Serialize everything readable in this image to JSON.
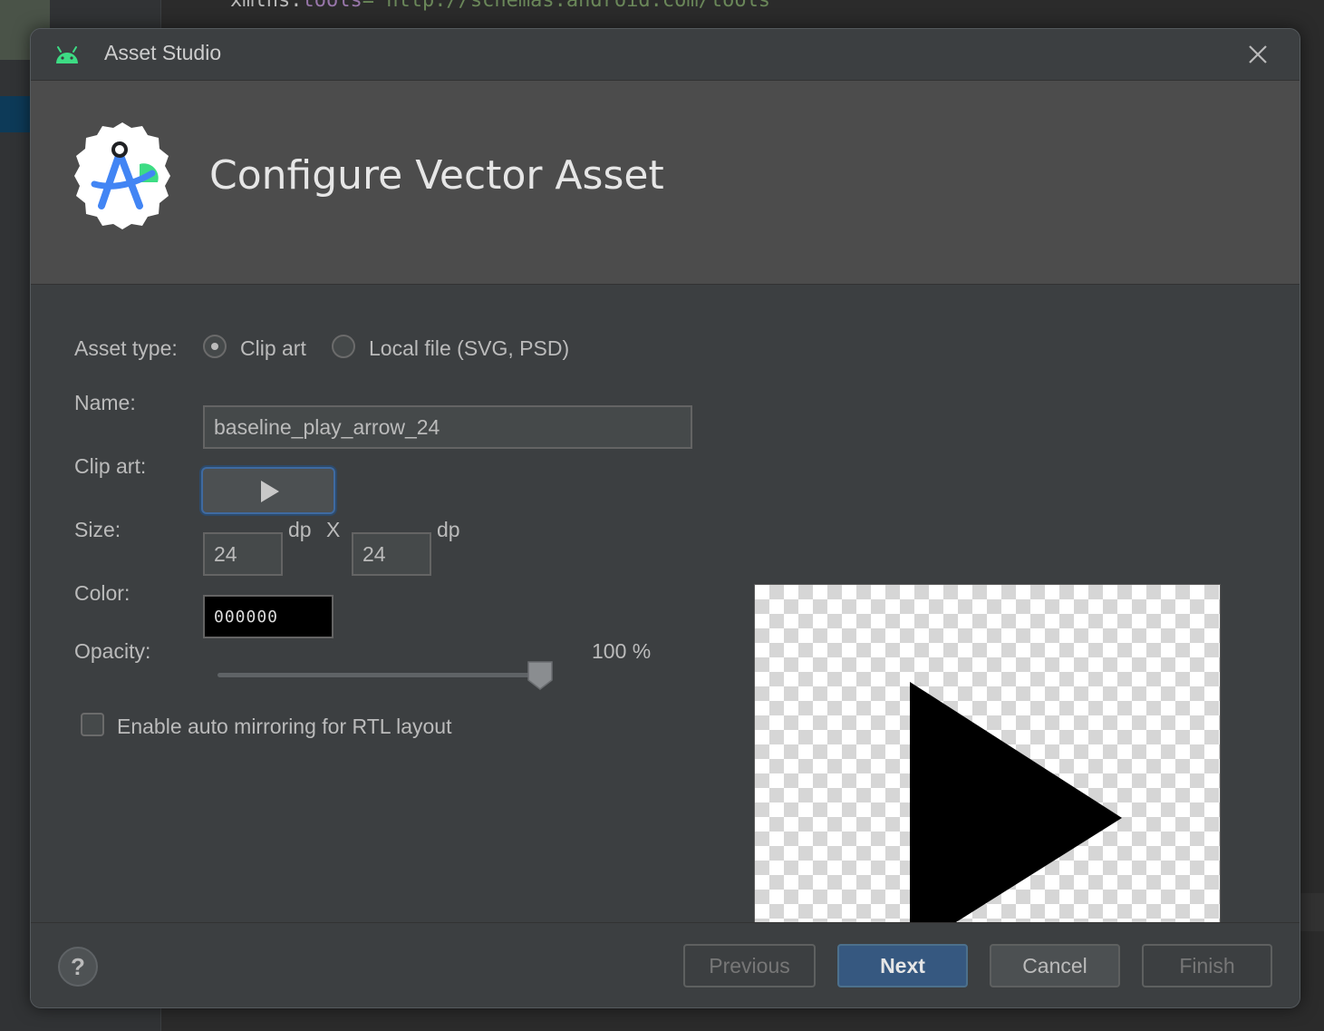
{
  "background_code": {
    "attr_name": "xmlns:",
    "attr_prefix": "tools",
    "attr_value": "=\"http://schemas.android.com/tools\""
  },
  "window": {
    "title": "Asset Studio",
    "close_icon": "close-icon",
    "app_icon": "android-icon"
  },
  "header": {
    "title": "Configure Vector Asset",
    "logo_icon": "android-studio-logo"
  },
  "form": {
    "asset_type_label": "Asset type:",
    "asset_type_options": [
      {
        "label": "Clip art",
        "checked": true
      },
      {
        "label": "Local file (SVG, PSD)",
        "checked": false
      }
    ],
    "name_label": "Name:",
    "name_value": "baseline_play_arrow_24",
    "clip_art_label": "Clip art:",
    "clip_art_icon": "play-arrow-icon",
    "size_label": "Size:",
    "width_value": "24",
    "width_unit": "dp",
    "size_separator": "X",
    "height_value": "24",
    "height_unit": "dp",
    "color_label": "Color:",
    "color_value": "000000",
    "opacity_label": "Opacity:",
    "opacity_value_text": "100 %",
    "opacity_level": 1.0,
    "rtl_checkbox_label": "Enable auto mirroring for RTL layout",
    "rtl_checked": false
  },
  "preview": {
    "icon": "play-arrow-icon",
    "fill_color": "#000000"
  },
  "footer": {
    "help_label": "?",
    "previous_label": "Previous",
    "next_label": "Next",
    "cancel_label": "Cancel",
    "finish_label": "Finish"
  },
  "colors": {
    "dialog_bg": "#3c3f41",
    "header_bg": "#4c4c4c",
    "accent": "#365880",
    "android_green": "#3ddc84"
  }
}
